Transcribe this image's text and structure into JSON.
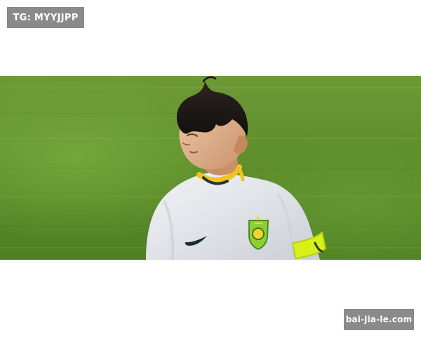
{
  "watermarks": {
    "top_left": "TG: MYYJJPP",
    "bottom_right": "bai-jia-le.com"
  },
  "colors": {
    "background": "#ffffff",
    "pitch": "#5e8e2b",
    "pitch_dark": "#4e7e22",
    "jersey": "#e8ebef",
    "jersey_trim": "#f4c21f",
    "armband": "#d8ef18",
    "watermark_bg": "#8a8a8a",
    "watermark_text": "#ffffff"
  },
  "icons": {
    "logo": "team-crest-icon",
    "swoosh": "nike-logo-icon",
    "armband": "armband-icon"
  }
}
